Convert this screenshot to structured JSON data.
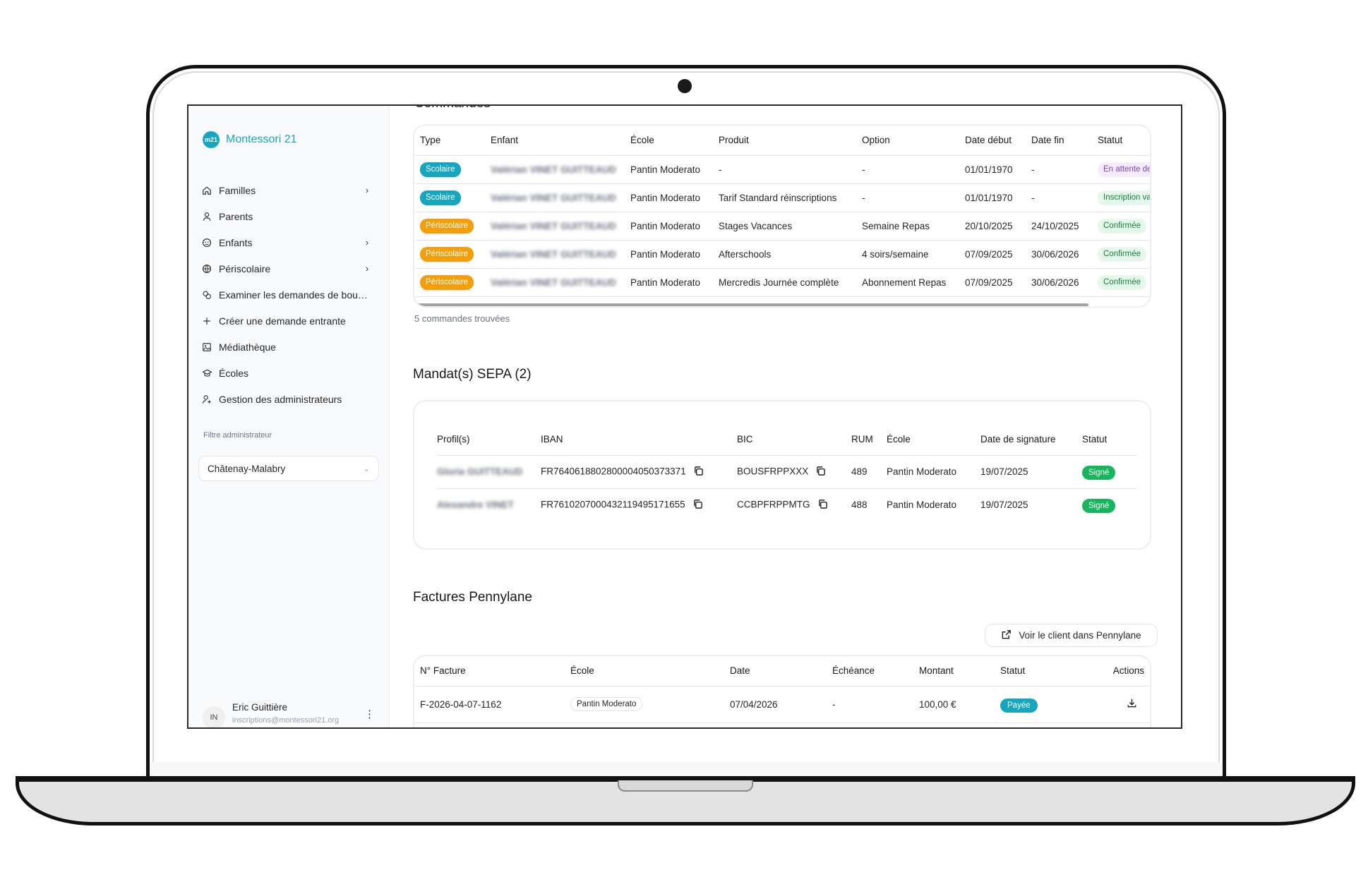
{
  "app": {
    "brand": "Montessori 21",
    "brand_logo_text": "m21",
    "accent": "#17a6c0"
  },
  "sidebar": {
    "items": [
      {
        "label": "Familles",
        "icon": "home-icon",
        "has_chevron": true
      },
      {
        "label": "Parents",
        "icon": "user-icon",
        "has_chevron": false
      },
      {
        "label": "Enfants",
        "icon": "child-face-icon",
        "has_chevron": true
      },
      {
        "label": "Périscolaire",
        "icon": "ball-icon",
        "has_chevron": true
      },
      {
        "label": "Examiner les demandes de bou…",
        "icon": "scholarship-icon",
        "has_chevron": false
      },
      {
        "label": "Créer une demande entrante",
        "icon": "plus-icon",
        "has_chevron": false
      },
      {
        "label": "Médiathèque",
        "icon": "image-icon",
        "has_chevron": false
      },
      {
        "label": "Écoles",
        "icon": "graduation-cap-icon",
        "has_chevron": false
      },
      {
        "label": "Gestion des administrateurs",
        "icon": "user-add-icon",
        "has_chevron": false
      }
    ],
    "filter_label": "Filtre administrateur",
    "filter_value": "Châtenay-Malabry",
    "user": {
      "initials": "IN",
      "name": "Eric Guittière",
      "email": "inscriptions@montessori21.org"
    }
  },
  "orders": {
    "title": "Commandes",
    "columns": [
      "Type",
      "Enfant",
      "École",
      "Produit",
      "Option",
      "Date début",
      "Date fin",
      "Statut"
    ],
    "rows": [
      {
        "type": "Scolaire",
        "child": "Valérian VINET GUITTEAUD",
        "school": "Pantin Moderato",
        "product": "-",
        "option": "-",
        "start": "01/01/1970",
        "end": "-",
        "status": "En attente de",
        "status_kind": "wait"
      },
      {
        "type": "Scolaire",
        "child": "Valérian VINET GUITTEAUD",
        "school": "Pantin Moderato",
        "product": "Tarif Standard réinscriptions",
        "option": "-",
        "start": "01/01/1970",
        "end": "-",
        "status": "Inscription va",
        "status_kind": "ok"
      },
      {
        "type": "Périscolaire",
        "child": "Valérian VINET GUITTEAUD",
        "school": "Pantin Moderato",
        "product": "Stages Vacances",
        "option": "Semaine Repas",
        "start": "20/10/2025",
        "end": "24/10/2025",
        "status": "Confirmée",
        "status_kind": "ok"
      },
      {
        "type": "Périscolaire",
        "child": "Valérian VINET GUITTEAUD",
        "school": "Pantin Moderato",
        "product": "Afterschools",
        "option": "4 soirs/semaine",
        "start": "07/09/2025",
        "end": "30/06/2026",
        "status": "Confirmée",
        "status_kind": "ok"
      },
      {
        "type": "Périscolaire",
        "child": "Valérian VINET GUITTEAUD",
        "school": "Pantin Moderato",
        "product": "Mercredis Journée complète",
        "option": "Abonnement Repas",
        "start": "07/09/2025",
        "end": "30/06/2026",
        "status": "Confirmée",
        "status_kind": "ok"
      }
    ],
    "count_text": "5 commandes trouvées"
  },
  "sepa": {
    "title": "Mandat(s) SEPA (2)",
    "columns": [
      "Profil(s)",
      "IBAN",
      "BIC",
      "RUM",
      "École",
      "Date de signature",
      "Statut"
    ],
    "rows": [
      {
        "profile": "Gloria GUITTEAUD",
        "iban": "FR7640618802800004050373371",
        "bic": "BOUSFRPPXXX",
        "rum": "489",
        "school": "Pantin Moderato",
        "date": "19/07/2025",
        "status": "Signé"
      },
      {
        "profile": "Alexandre VINET",
        "iban": "FR7610207000432119495171655",
        "bic": "CCBPFRPPMTG",
        "rum": "488",
        "school": "Pantin Moderato",
        "date": "19/07/2025",
        "status": "Signé"
      }
    ]
  },
  "invoices": {
    "title": "Factures Pennylane",
    "open_button": "Voir le client dans Pennylane",
    "columns": [
      "N° Facture",
      "École",
      "Date",
      "Échéance",
      "Montant",
      "Statut",
      "Actions"
    ],
    "rows": [
      {
        "number": "F-2026-04-07-1162",
        "school": "Pantin Moderato",
        "date": "07/04/2026",
        "due": "-",
        "amount": "100,00 €",
        "status": "Payée"
      }
    ]
  }
}
